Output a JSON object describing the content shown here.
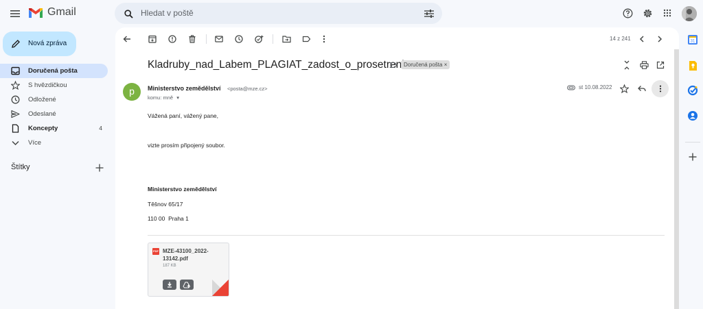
{
  "header": {
    "app_name": "Gmail",
    "search_placeholder": "Hledat v poště"
  },
  "sidebar": {
    "compose_label": "Nová zpráva",
    "items": [
      {
        "label": "Doručená pošta",
        "icon": "inbox-icon",
        "count": ""
      },
      {
        "label": "S hvězdičkou",
        "icon": "star-icon",
        "count": ""
      },
      {
        "label": "Odložené",
        "icon": "clock-icon",
        "count": ""
      },
      {
        "label": "Odeslané",
        "icon": "send-icon",
        "count": ""
      },
      {
        "label": "Koncepty",
        "icon": "draft-icon",
        "count": "4"
      },
      {
        "label": "Více",
        "icon": "chevron-down-icon",
        "count": ""
      }
    ],
    "labels_title": "Štítky"
  },
  "toolbar": {
    "pager": "14 z 241"
  },
  "message": {
    "subject": "Kladruby_nad_Labem_PLAGIAT_zadost_o_prosetreni",
    "label_chip": "Doručená pošta ×",
    "avatar_letter": "p",
    "sender_name": "Ministerstvo zemědělství",
    "sender_email": "<posta@mze.cz>",
    "to_line": "komu: mně",
    "date": "st 10.08.2022",
    "body": {
      "greeting": "Vážená paní, vážený pane,",
      "line1": "vizte prosím připojený soubor.",
      "signature_org": "Ministerstvo zemědělství",
      "address1": "Těšnov 65/17",
      "address2": "110 00  Praha 1"
    },
    "attachment": {
      "type_badge": "PDF",
      "filename": "MZE-43100_2022-13142.pdf",
      "size": "187 KB"
    }
  },
  "colors": {
    "accent": "#c2e7ff",
    "active_nav": "#d3e3fd",
    "avatar": "#7cb342",
    "pdf_red": "#ea4335"
  }
}
